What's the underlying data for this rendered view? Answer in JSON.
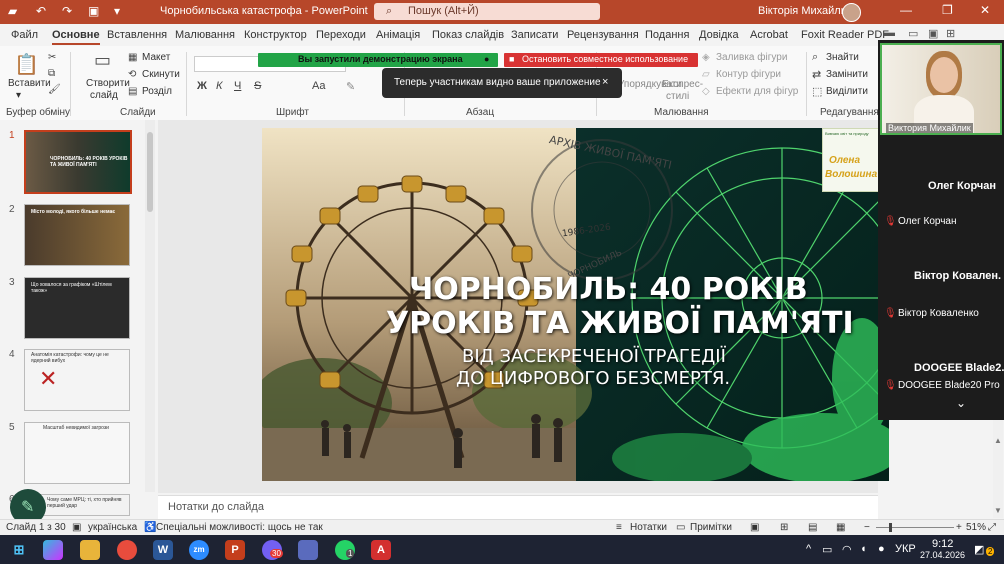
{
  "titlebar": {
    "title": "Чорнобильська катастрофа  -  PowerPoint",
    "search_placeholder": "Пошук (Alt+Й)",
    "user": "Вікторія Михайлик",
    "undo": "↶",
    "redo": "↷",
    "save": "▣"
  },
  "tabs": [
    "Файл",
    "Основне",
    "Вставлення",
    "Малювання",
    "Конструктор",
    "Переходи",
    "Анімація",
    "Показ слайдів",
    "Записати",
    "Рецензування",
    "Подання",
    "Довідка",
    "Acrobat",
    "Foxit Reader PDF"
  ],
  "ribbon": {
    "paste": "Вставити",
    "new_slide_1": "Створити",
    "new_slide_2": "слайд",
    "layout": "Макет",
    "reset": "Скинути",
    "section": "Розділ",
    "groups": {
      "clipboard": "Буфер обміну",
      "slides": "Слайди",
      "font": "Шрифт",
      "paragraph": "Абзац",
      "drawing": "Малювання",
      "editing": "Редагування"
    },
    "find": "Знайти",
    "replace": "Замінити",
    "select": "Виділити",
    "fill": "Заливка фігури",
    "outline": "Контур фігури",
    "effects": "Ефекти для фігур",
    "arrange": "Упорядкувати",
    "styles_1": "Експрес-",
    "styles_2": "стилі",
    "font_bold": "Ж",
    "font_italic": "К",
    "font_underline": "Ч",
    "font_strike": "S",
    "font_size": "Aa"
  },
  "share": {
    "started": "Вы запустили демонстрацию экрана",
    "stop": "Остановить совместное использование",
    "toast": "Теперь участникам видно ваше приложение",
    "close": "×"
  },
  "thumbnails": [
    {
      "num": "1",
      "text": "ЧОРНОБИЛЬ: 40 РОКІВ УРОКІВ ТА ЖИВОЇ ПАМ'ЯТІ"
    },
    {
      "num": "2",
      "text": "Місто молоді, якого більше немає"
    },
    {
      "num": "3",
      "text": "Що ховалося за графіком «Штілем також»"
    },
    {
      "num": "4",
      "text": "Анатомія катастрофи: чому це не ядерний вибух"
    },
    {
      "num": "5",
      "text": "Масштаб невидимої загрози"
    },
    {
      "num": "6",
      "text": "Чому саме МРЦ: ті, хто прийняв перший удар"
    }
  ],
  "slide": {
    "title_line1": "ЧОРНОБИЛЬ: 40 РОКІВ",
    "title_line2": "УРОКІВ ТА ЖИВОЇ ПАМ'ЯТІ",
    "subtitle_line1": "ВІД ЗАСЕКРЕЧЕНОЇ ТРАГЕДІЇ",
    "subtitle_line2": "ДО ЦИФРОВОГО БЕЗСМЕРТЯ.",
    "stamp_text": "АРХІВ ЖИВОЇ ПАМ'ЯТІ",
    "stamp_sub": "ЧОРНОБИЛЬ",
    "stamp_years": "1986-2026",
    "logo_top": "Вивчаю світ та природу",
    "logo_name_1": "Олена",
    "logo_name_2": "Волошина"
  },
  "notes": "Нотатки до слайда",
  "status": {
    "slide": "Слайд 1 з 30",
    "lang": "українська",
    "access": "Спеціальні можливості: щось не так",
    "notes": "Нотатки",
    "comments": "Примітки",
    "zoom": "51%"
  },
  "video": {
    "host_name": "Виктория Михайлик",
    "participants": [
      {
        "big": "Олег Корчан",
        "small": "Олег Корчан"
      },
      {
        "big": "Віктор  Ковален.",
        "small": "Віктор Коваленко"
      },
      {
        "big": "DOOGEE  Blade2.",
        "small": "DOOGEE Blade20 Pro"
      }
    ]
  },
  "taskbar": {
    "lang": "УКР",
    "time": "9:12",
    "date": "27.04.2026",
    "badge_viber": "30",
    "badge_whatsapp": "1",
    "badge_notif": "2"
  }
}
